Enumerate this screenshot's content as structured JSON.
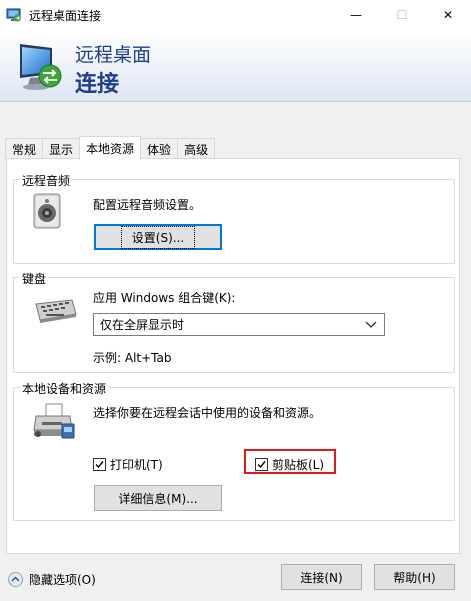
{
  "window": {
    "title": "远程桌面连接",
    "minimize_glyph": "—",
    "maximize_glyph": "☐",
    "close_glyph": "✕"
  },
  "banner": {
    "line1": "远程桌面",
    "line2": "连接",
    "icon": "monitor-remote-icon"
  },
  "tabs": [
    {
      "label": "常规"
    },
    {
      "label": "显示"
    },
    {
      "label": "本地资源",
      "active": true
    },
    {
      "label": "体验"
    },
    {
      "label": "高级"
    }
  ],
  "audio": {
    "legend": "远程音频",
    "description": "配置远程音频设置。",
    "settings_button": "设置(S)...",
    "icon": "speaker-icon"
  },
  "keyboard": {
    "legend": "键盘",
    "label": "应用 Windows 组合键(K):",
    "selected": "仅在全屏显示时",
    "example": "示例: Alt+Tab",
    "icon": "keyboard-icon"
  },
  "devices": {
    "legend": "本地设备和资源",
    "description": "选择你要在远程会话中使用的设备和资源。",
    "printers_label": "打印机(T)",
    "printers_checked": true,
    "clipboard_label": "剪贴板(L)",
    "clipboard_checked": true,
    "details_button": "详细信息(M)...",
    "icon": "printer-devices-icon",
    "highlight_color": "#e01818"
  },
  "footer": {
    "hide_options": "隐藏选项(O)",
    "connect_button": "连接(N)",
    "help_button": "帮助(H)"
  },
  "colors": {
    "accent": "#0078d7",
    "banner_text": "#1e3e8c"
  }
}
